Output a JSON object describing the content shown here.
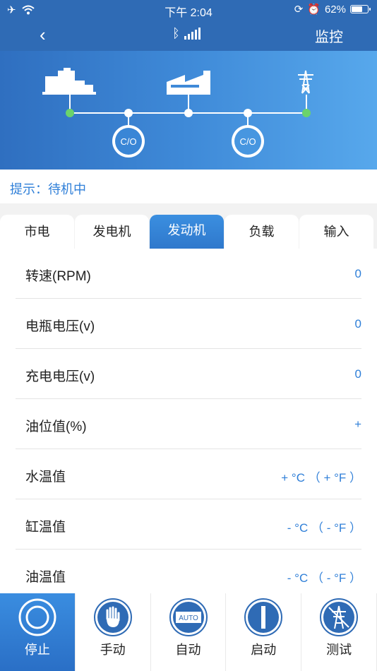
{
  "status": {
    "time": "下午 2:04",
    "battery": "62%"
  },
  "nav": {
    "back_icon": "chevron-left-icon",
    "right_label": "监控"
  },
  "diagram": {
    "breaker_left": "C/O",
    "breaker_right": "C/O"
  },
  "hint": {
    "text": "提示：待机中"
  },
  "tabs": [
    {
      "label": "市电"
    },
    {
      "label": "发电机"
    },
    {
      "label": "发动机",
      "active": true
    },
    {
      "label": "负载"
    },
    {
      "label": "输入"
    }
  ],
  "rows": [
    {
      "label": "转速(RPM)",
      "value": "0"
    },
    {
      "label": "电瓶电压(v)",
      "value": "0"
    },
    {
      "label": "充电电压(v)",
      "value": "0"
    },
    {
      "label": "油位值(%)",
      "value": "+"
    },
    {
      "label": "水温值",
      "value": "+ °C  （ + °F ）"
    },
    {
      "label": "缸温值",
      "value": "- °C  （ - °F ）"
    },
    {
      "label": "油温值",
      "value": "- °C  （ - °F ）"
    }
  ],
  "toolbar": [
    {
      "label": "停止",
      "icon": "stop-icon",
      "active": true
    },
    {
      "label": "手动",
      "icon": "hand-icon"
    },
    {
      "label": "自动",
      "icon": "auto-icon",
      "badge": "AUTO"
    },
    {
      "label": "启动",
      "icon": "power-start-icon"
    },
    {
      "label": "测试",
      "icon": "tower-test-icon"
    }
  ],
  "colors": {
    "primary": "#2f6bb5",
    "accent": "#2f7fd8",
    "node_green": "#6bd36b"
  }
}
